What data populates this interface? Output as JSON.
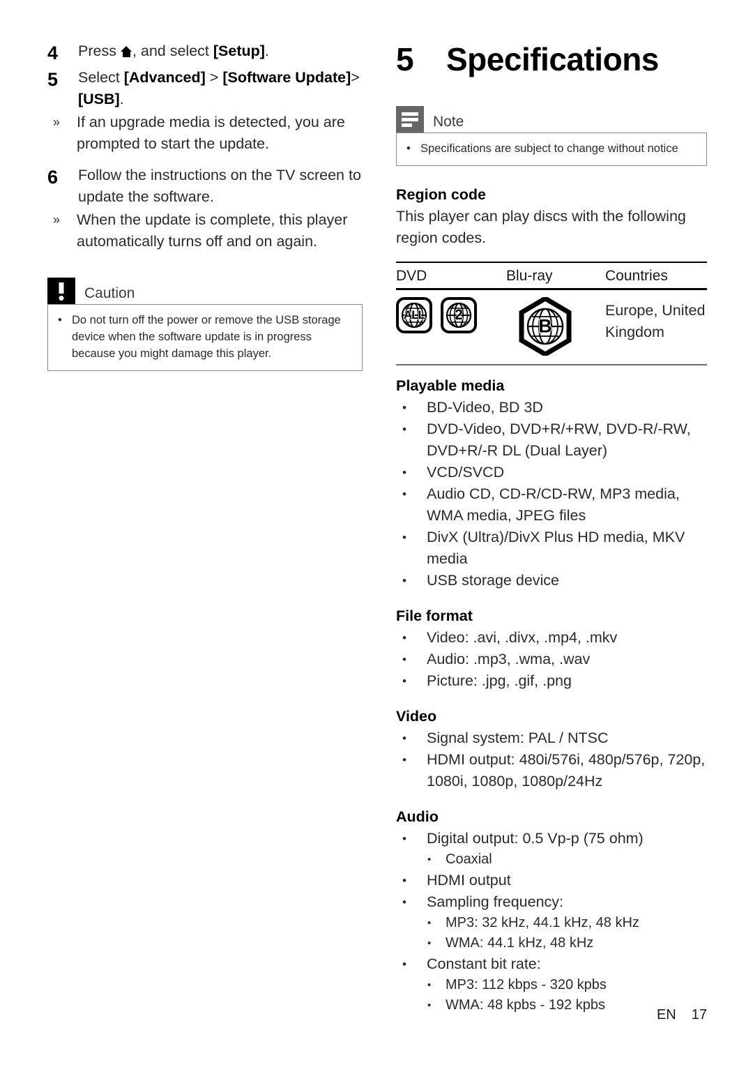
{
  "left_column": {
    "steps": [
      {
        "number": "4",
        "text_parts": [
          "Press ",
          " , and select ",
          "[Setup]",
          "."
        ],
        "plain": "Press , and select [Setup].",
        "bold_label": "[Setup]",
        "icon": "home-icon"
      },
      {
        "number": "5",
        "plain": "Select [Advanced] > [Software Update]> [USB].",
        "bold_1": "[Advanced]",
        "bold_2": "[Software Update]",
        "bold_3": "[USB]",
        "sub_bullets": [
          "If an upgrade media is detected, you are prompted to start the update."
        ]
      },
      {
        "number": "6",
        "plain": "Follow the instructions on the TV screen to update the software.",
        "sub_bullets": [
          "When the update is complete, this player automatically turns off and on again."
        ]
      }
    ],
    "caution": {
      "icon": "exclamation-icon",
      "title": "Caution",
      "items": [
        "Do not turn off the power or remove the USB storage device when the software update is in progress because you might damage this player."
      ]
    }
  },
  "right_column": {
    "chapter": {
      "number": "5",
      "title": "Specifications"
    },
    "note": {
      "icon": "note-lines-icon",
      "title": "Note",
      "items": [
        "Specifications are subject to change without notice"
      ]
    },
    "region_code": {
      "heading": "Region code",
      "intro": "This player can play discs with the following region codes.",
      "table": {
        "headers": [
          "DVD",
          "Blu-ray",
          "Countries"
        ],
        "dvd_logos": [
          "ALL",
          "2"
        ],
        "bluray_logo": "B",
        "countries": "Europe, United Kingdom"
      }
    },
    "playable_media": {
      "heading": "Playable media",
      "items": [
        "BD-Video, BD 3D",
        "DVD-Video, DVD+R/+RW, DVD-R/-RW, DVD+R/-R DL (Dual Layer)",
        "VCD/SVCD",
        "Audio CD, CD-R/CD-RW, MP3 media, WMA media, JPEG files",
        "DivX (Ultra)/DivX Plus HD media, MKV media",
        "USB storage device"
      ]
    },
    "file_format": {
      "heading": "File format",
      "items": [
        "Video: .avi, .divx, .mp4, .mkv",
        "Audio: .mp3, .wma, .wav",
        "Picture: .jpg, .gif, .png"
      ]
    },
    "video": {
      "heading": "Video",
      "items": [
        "Signal system: PAL / NTSC",
        "HDMI output: 480i/576i, 480p/576p, 720p, 1080i, 1080p, 1080p/24Hz"
      ]
    },
    "audio": {
      "heading": "Audio",
      "item_1": "Digital output: 0.5 Vp-p (75 ohm)",
      "item_1_sub": [
        "Coaxial"
      ],
      "item_2": "HDMI output",
      "item_3": "Sampling frequency:",
      "item_3_sub": [
        "MP3: 32 kHz, 44.1 kHz, 48 kHz",
        "WMA: 44.1 kHz, 48 kHz"
      ],
      "item_4": "Constant bit rate:",
      "item_4_sub": [
        "MP3: 112 kbps - 320 kpbs",
        "WMA: 48 kpbs - 192 kpbs"
      ]
    }
  },
  "footer": {
    "language": "EN",
    "page_number": "17"
  },
  "glyphs": {
    "bullet": "•",
    "sub_arrow": "»"
  },
  "colors": {
    "text": "#2a2a2a",
    "heading": "#000000",
    "note_icon_bg": "#666666",
    "caution_icon_bg": "#000000",
    "box_border": "#8a8a8a"
  }
}
